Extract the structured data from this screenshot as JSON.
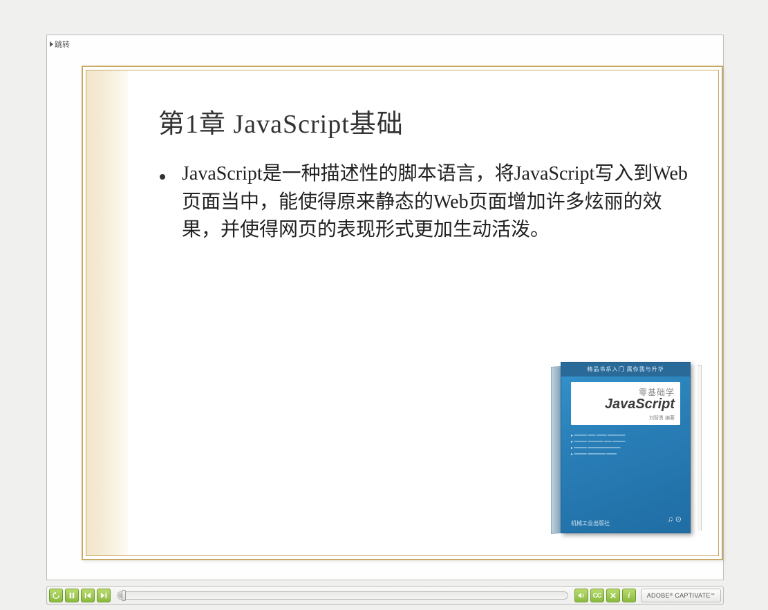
{
  "skip_label": "跳转",
  "slide": {
    "title": "第1章  JavaScript基础",
    "bullet": "JavaScript是一种描述性的脚本语言，将JavaScript写入到Web页面当中，能使得原来静态的Web页面增加许多炫丽的效果，并使得网页的表现形式更加生动活泼。"
  },
  "book": {
    "banner": "精品书系入门 属你我与升华",
    "subtitle": "零基础学",
    "title": "JavaScript",
    "author": "刘智勇  编著",
    "publisher": "机械工业出版社"
  },
  "controls": {
    "rewind": "rewind",
    "pause": "pause",
    "prev": "prev",
    "next": "next",
    "audio": "audio",
    "cc": "CC",
    "close": "close",
    "info": "i",
    "badge_prefix": "ADOBE",
    "badge_reg": "®",
    "badge_suffix": "CAPTIVATE",
    "badge_tm": "™"
  }
}
